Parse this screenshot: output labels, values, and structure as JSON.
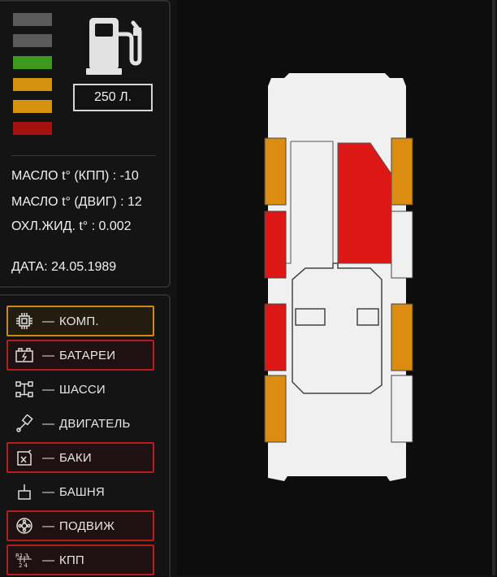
{
  "status": {
    "fuel_levels": [
      {
        "name": "level-1",
        "color": "#5a5a5a"
      },
      {
        "name": "level-2",
        "color": "#5a5a5a"
      },
      {
        "name": "level-3",
        "color": "#3e9a1f"
      },
      {
        "name": "level-4",
        "color": "#d4920f"
      },
      {
        "name": "level-5",
        "color": "#d4920f"
      },
      {
        "name": "level-6",
        "color": "#a3120f"
      }
    ],
    "fuel_icon": "fuel-pump-icon",
    "fuel_amount": "250 Л.",
    "stats": [
      {
        "label": "МАСЛО t° (КПП) :",
        "value": "-10"
      },
      {
        "label": "МАСЛО t° (ДВИГ) :",
        "value": "12"
      },
      {
        "label": "ОХЛ.ЖИД. t° :",
        "value": "0.002"
      }
    ],
    "date_label": "ДАТА:",
    "date_value": "24.05.1989"
  },
  "systems": {
    "dash": "—",
    "items": [
      {
        "icon": "processor-chip-icon",
        "label": "КОМП.",
        "state": "warning"
      },
      {
        "icon": "battery-icon",
        "label": "БАТАРЕИ",
        "state": "critical"
      },
      {
        "icon": "chassis-icon",
        "label": "ШАССИ",
        "state": "ok"
      },
      {
        "icon": "engine-piston-icon",
        "label": "ДВИГАТЕЛЬ",
        "state": "ok"
      },
      {
        "icon": "fuel-tank-icon",
        "label": "БАКИ",
        "state": "critical"
      },
      {
        "icon": "turret-icon",
        "label": "БАШНЯ",
        "state": "ok"
      },
      {
        "icon": "wheel-icon",
        "label": "ПОДВИЖ",
        "state": "critical"
      },
      {
        "icon": "gearbox-icon",
        "label": "КПП",
        "state": "critical"
      }
    ]
  },
  "vehicle": {
    "state_colors": {
      "warning": "#dc8c10",
      "critical": "#dd1616",
      "ok": "#f0f0f0"
    },
    "left_wheels": [
      "warning",
      "critical",
      "critical",
      "warning"
    ],
    "right_wheels": [
      "warning",
      "ok",
      "warning",
      "ok"
    ],
    "engine_bay": "critical",
    "hull_color": "#f0f0f0"
  }
}
